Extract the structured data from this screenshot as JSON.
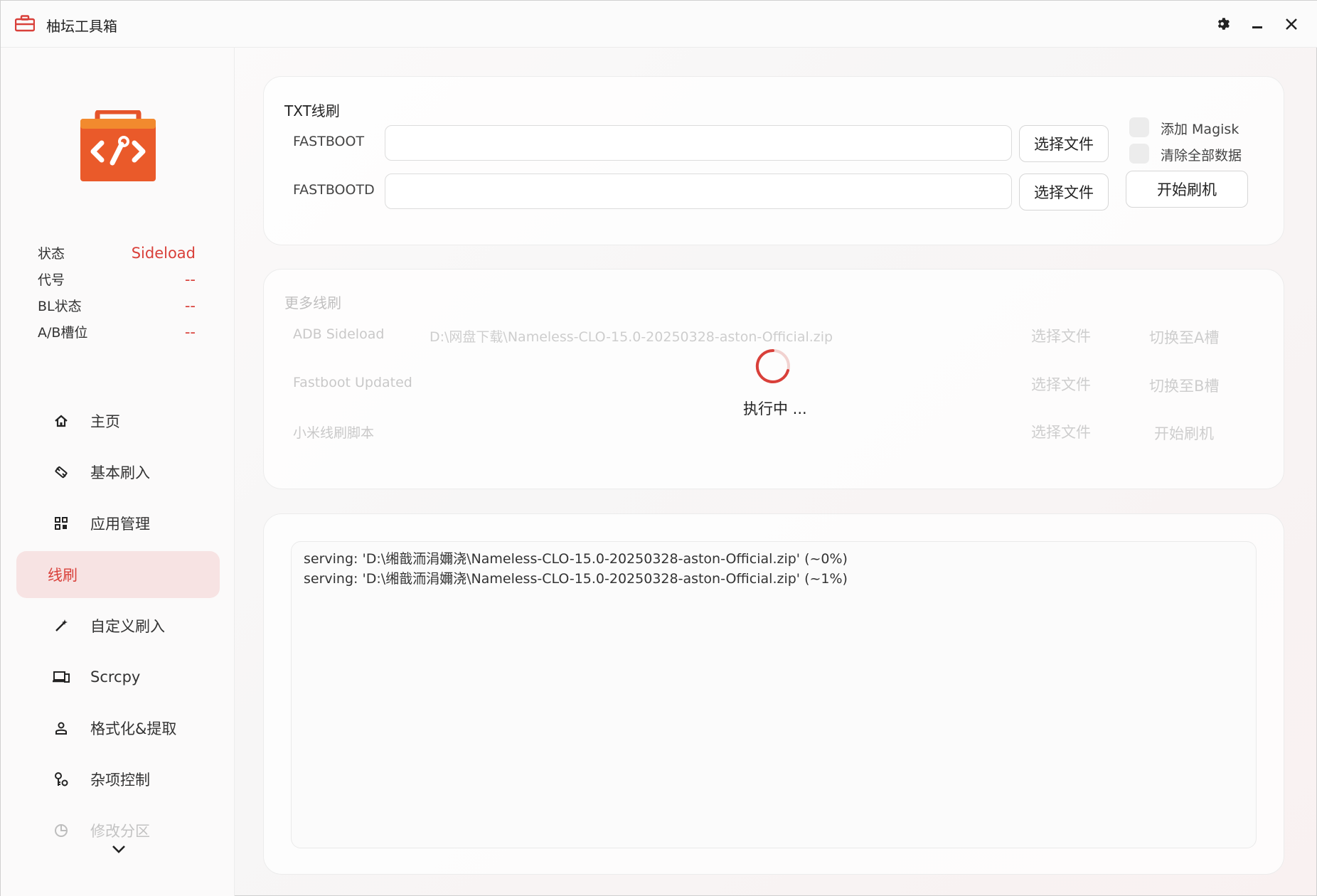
{
  "window": {
    "title": "柚坛工具箱"
  },
  "colors": {
    "accent": "#d9403a",
    "active_nav_bg": "#f7e3e3",
    "logo": "#ea5a2a"
  },
  "status": {
    "rows": [
      {
        "key": "状态",
        "value": "Sideload"
      },
      {
        "key": "代号",
        "value": "--"
      },
      {
        "key": "BL状态",
        "value": "--"
      },
      {
        "key": "A/B槽位",
        "value": "--"
      }
    ]
  },
  "nav": {
    "items": [
      {
        "label": "主页",
        "icon": "home-icon"
      },
      {
        "label": "基本刷入",
        "icon": "flash-icon"
      },
      {
        "label": "应用管理",
        "icon": "apps-icon"
      },
      {
        "label": "线刷",
        "icon": "",
        "active": true
      },
      {
        "label": "自定义刷入",
        "icon": "wand-icon"
      },
      {
        "label": "Scrcpy",
        "icon": "devices-icon"
      },
      {
        "label": "格式化&提取",
        "icon": "person-icon"
      },
      {
        "label": "杂项控制",
        "icon": "key-gear-icon"
      },
      {
        "label": "修改分区",
        "icon": "pie-icon"
      }
    ]
  },
  "footer_icons": [
    "terminal-icon",
    "github-icon",
    "chat-icon"
  ],
  "txt_flash": {
    "title": "TXT线刷",
    "rows": [
      {
        "label": "FASTBOOT",
        "value": "",
        "button": "选择文件"
      },
      {
        "label": "FASTBOOTD",
        "value": "",
        "button": "选择文件"
      }
    ],
    "options": [
      {
        "label": "添加 Magisk",
        "checked": false
      },
      {
        "label": "清除全部数据",
        "checked": false
      }
    ],
    "start_button": "开始刷机"
  },
  "more_flash": {
    "title": "更多线刷",
    "rows": [
      {
        "label": "ADB Sideload",
        "value": "D:\\网盘下载\\Nameless-CLO-15.0-20250328-aston-Official.zip",
        "button": "选择文件",
        "action": "切换至A槽"
      },
      {
        "label": "Fastboot Updated",
        "value": "",
        "button": "选择文件",
        "action": "切换至B槽"
      },
      {
        "label": "小米线刷脚本",
        "value": "",
        "button": "选择文件",
        "action": "开始刷机"
      }
    ]
  },
  "loading": {
    "text": "执行中 ..."
  },
  "log": {
    "lines": [
      "serving: 'D:\\缃戠洏涓嬭浇\\Nameless-CLO-15.0-20250328-aston-Official.zip'  (~0%)",
      "serving: 'D:\\缃戠洏涓嬭浇\\Nameless-CLO-15.0-20250328-aston-Official.zip'  (~1%)"
    ]
  }
}
